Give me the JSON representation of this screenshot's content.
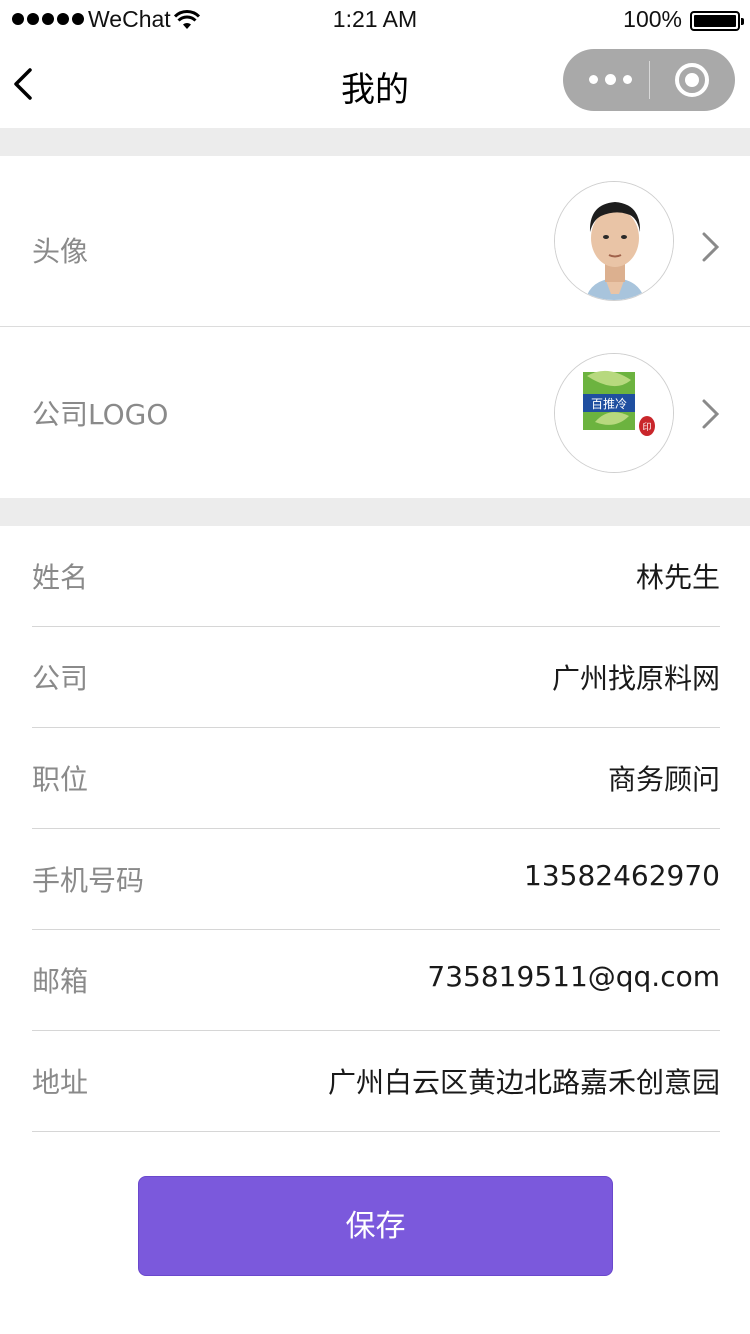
{
  "status_bar": {
    "carrier": "WeChat",
    "time": "1:21 AM",
    "battery": "100%",
    "battery_level": 1.0
  },
  "nav": {
    "title": "我的",
    "icons": [
      "back-chevron-icon",
      "more-dots-icon",
      "close-circle-icon"
    ]
  },
  "profile_images": {
    "avatar_label": "头像",
    "logo_label": "公司LOGO",
    "logo_text": "百推冷"
  },
  "fields": [
    {
      "label": "姓名",
      "value": "林先生"
    },
    {
      "label": "公司",
      "value": "广州找原料网"
    },
    {
      "label": "职位",
      "value": "商务顾问"
    },
    {
      "label": "手机号码",
      "value": "13582462970"
    },
    {
      "label": "邮箱",
      "value": "735819511@qq.com"
    },
    {
      "label": "地址",
      "value": "广州白云区黄边北路嘉禾创意园"
    }
  ],
  "actions": {
    "save_label": "保存"
  },
  "colors": {
    "accent": "#7b59dc",
    "section_gap": "#ececec",
    "label_gray": "#8a8a8a",
    "capsule": "#a9a9a9"
  }
}
